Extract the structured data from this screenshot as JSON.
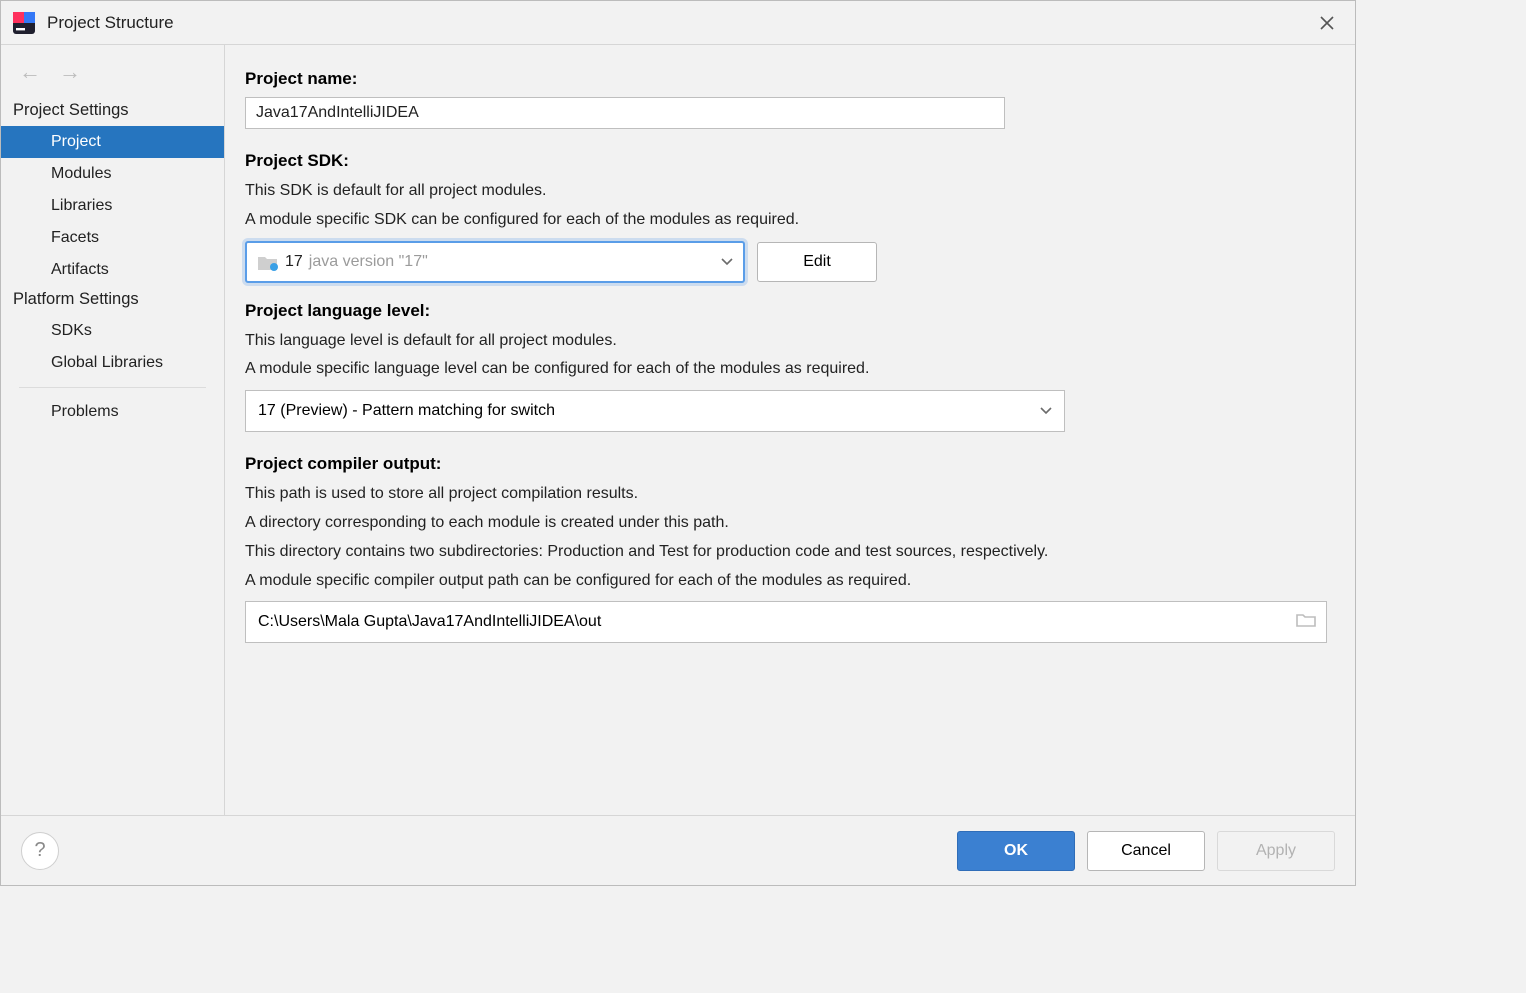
{
  "window": {
    "title": "Project Structure"
  },
  "sidebar": {
    "group1_header": "Project Settings",
    "group2_header": "Platform Settings",
    "items": {
      "project": "Project",
      "modules": "Modules",
      "libraries": "Libraries",
      "facets": "Facets",
      "artifacts": "Artifacts",
      "sdks": "SDKs",
      "global_libraries": "Global Libraries",
      "problems": "Problems"
    }
  },
  "project": {
    "name_label": "Project name:",
    "name_value": "Java17AndIntelliJIDEA",
    "sdk_label": "Project SDK:",
    "sdk_desc1": "This SDK is default for all project modules.",
    "sdk_desc2": "A module specific SDK can be configured for each of the modules as required.",
    "sdk_value_main": "17",
    "sdk_value_sub": "java version \"17\"",
    "sdk_edit_label": "Edit",
    "lang_label": "Project language level:",
    "lang_desc1": "This language level is default for all project modules.",
    "lang_desc2": "A module specific language level can be configured for each of the modules as required.",
    "lang_value": "17 (Preview) - Pattern matching for switch",
    "output_label": "Project compiler output:",
    "output_desc1": "This path is used to store all project compilation results.",
    "output_desc2": "A directory corresponding to each module is created under this path.",
    "output_desc3": "This directory contains two subdirectories: Production and Test for production code and test sources, respectively.",
    "output_desc4": "A module specific compiler output path can be configured for each of the modules as required.",
    "output_value": "C:\\Users\\Mala Gupta\\Java17AndIntelliJIDEA\\out"
  },
  "footer": {
    "ok": "OK",
    "cancel": "Cancel",
    "apply": "Apply"
  }
}
